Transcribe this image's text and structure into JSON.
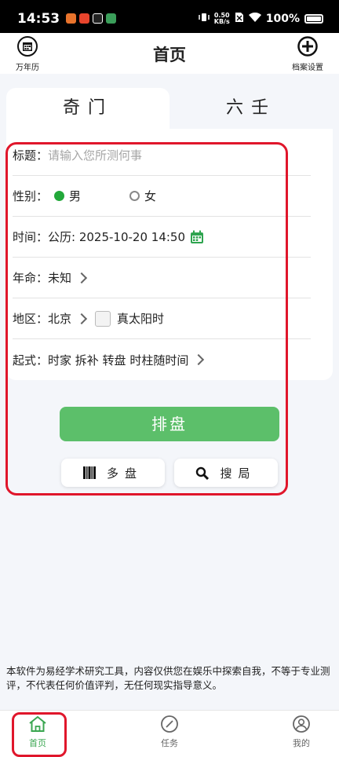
{
  "status": {
    "time": "14:53",
    "speed_top": "0.50",
    "speed_unit": "KB/s",
    "battery": "100%"
  },
  "header": {
    "title": "首页",
    "left_label": "万年历",
    "right_label": "档案设置"
  },
  "tabs": [
    "奇门",
    "六壬"
  ],
  "form": {
    "title_label": "标题：",
    "title_placeholder": "请输入您所测何事",
    "gender_label": "性别：",
    "gender_male": "男",
    "gender_female": "女",
    "time_label": "时间：",
    "time_value": "公历: 2025-10-20 14:50",
    "age_label": "年命：",
    "age_value": "未知",
    "region_label": "地区：",
    "region_value": "北京",
    "solar_time": "真太阳时",
    "method_label": "起式：",
    "method_value": "时家 拆补 转盘 时柱随时间"
  },
  "buttons": {
    "main": "排盘",
    "multi": "多盘",
    "search": "搜局"
  },
  "disclaimer": "本软件为易经学术研究工具，内容仅供您在娱乐中探索自我，不等于专业测评，不代表任何价值评判，无任何现实指导意义。",
  "nav": {
    "home": "首页",
    "task": "任务",
    "mine": "我的"
  },
  "colors": {
    "accent": "#5cbf6a",
    "active_nav": "#3aa650",
    "highlight": "#e0162b"
  }
}
